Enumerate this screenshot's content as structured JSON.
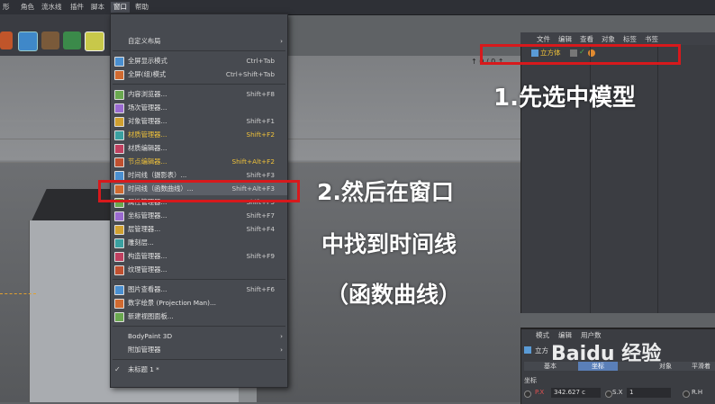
{
  "menubar": {
    "items": [
      "形",
      "角色",
      "流水线",
      "插件",
      "脚本",
      "窗口",
      "帮助"
    ],
    "active": "窗口"
  },
  "dropdown": {
    "items": [
      {
        "label": "自定义布局",
        "shortcut": "",
        "arrow": "›",
        "icon": "",
        "style": "normal"
      },
      {
        "label": "全屏显示模式",
        "shortcut": "Ctrl+Tab",
        "icon": "grid-icon",
        "style": "normal"
      },
      {
        "label": "全屏(组)模式",
        "shortcut": "Ctrl+Shift+Tab",
        "icon": "grid-icon",
        "style": "normal"
      },
      {
        "label": "内容浏览器...",
        "shortcut": "Shift+F8",
        "icon": "browser-icon",
        "style": "normal"
      },
      {
        "label": "场次管理器...",
        "shortcut": "",
        "icon": "take-icon",
        "style": "normal"
      },
      {
        "label": "对象管理器...",
        "shortcut": "Shift+F1",
        "icon": "object-manager-icon",
        "style": "normal"
      },
      {
        "label": "材质管理器...",
        "shortcut": "Shift+F2",
        "icon": "material-icon",
        "style": "yellow"
      },
      {
        "label": "材质编辑器...",
        "shortcut": "",
        "icon": "material-editor-icon",
        "style": "normal"
      },
      {
        "label": "节点编辑器...",
        "shortcut": "Shift+Alt+F2",
        "icon": "node-editor-icon",
        "style": "yellow"
      },
      {
        "label": "时间线（摄影表）...",
        "shortcut": "Shift+F3",
        "icon": "dopesheet-icon",
        "style": "normal"
      },
      {
        "label": "时间线（函数曲线）...",
        "shortcut": "Shift+Alt+F3",
        "icon": "f-curve-icon",
        "style": "highlight"
      },
      {
        "label": "属性管理器...",
        "shortcut": "Shift+F5",
        "icon": "attribute-icon",
        "style": "normal"
      },
      {
        "label": "坐标管理器...",
        "shortcut": "Shift+F7",
        "icon": "coordinate-icon",
        "style": "normal"
      },
      {
        "label": "层管理器...",
        "shortcut": "Shift+F4",
        "icon": "layer-icon",
        "style": "normal"
      },
      {
        "label": "雕刻层...",
        "shortcut": "",
        "icon": "sculpt-icon",
        "style": "normal"
      },
      {
        "label": "构造管理器...",
        "shortcut": "Shift+F9",
        "icon": "structure-icon",
        "style": "normal"
      },
      {
        "label": "纹理管理器...",
        "shortcut": "",
        "icon": "texture-icon",
        "style": "normal"
      },
      {
        "label": "图片查看器...",
        "shortcut": "Shift+F6",
        "icon": "picture-viewer-icon",
        "style": "normal"
      },
      {
        "label": "数字绘景 (Projection Man)...",
        "shortcut": "",
        "icon": "projection-icon",
        "style": "normal"
      },
      {
        "label": "新建视图面板...",
        "shortcut": "",
        "icon": "viewport-icon",
        "style": "normal"
      },
      {
        "label": "BodyPaint 3D",
        "shortcut": "",
        "arrow": "›",
        "icon": "",
        "style": "normal"
      },
      {
        "label": "附加管理器",
        "shortcut": "",
        "arrow": "›",
        "icon": "",
        "style": "normal"
      },
      {
        "label": "未标题 1 *",
        "shortcut": "",
        "icon": "check-icon",
        "style": "normal"
      }
    ]
  },
  "object_manager": {
    "menu": [
      "文件",
      "编辑",
      "查看",
      "对象",
      "标签",
      "书签"
    ],
    "object_name": "立方体"
  },
  "attribute_manager": {
    "menu": [
      "模式",
      "编辑",
      "用户数"
    ],
    "object_label": "立方",
    "tabs": [
      "基本",
      "坐标",
      "对象",
      "平滑着"
    ],
    "coord_label": "坐标",
    "px_label": "P.X",
    "px_value": "342.627 c",
    "sx_label": "S.X",
    "sx_value": "1",
    "rh_label": "R.H"
  },
  "viewport": {
    "status": "↑ 0 / 0 ↑"
  },
  "annotations": {
    "step1": "1.先选中模型",
    "step2_line1": "2.然后在窗口",
    "step2_line2": "中找到时间线",
    "step2_line3": "（函数曲线）"
  },
  "watermark": "Baidu 经验",
  "colors": {
    "highlight_box": "#d7191c",
    "menu_yellow": "#f0c23a",
    "selection": "#e0a030"
  }
}
